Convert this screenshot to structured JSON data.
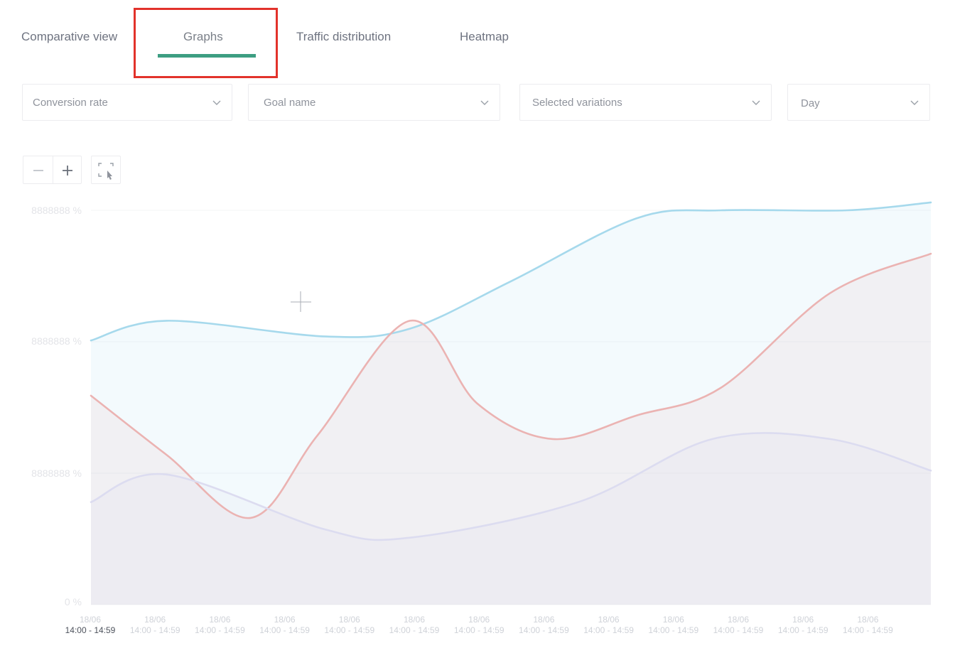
{
  "tabs": [
    {
      "label": "Comparative view"
    },
    {
      "label": "Graphs"
    },
    {
      "label": "Traffic distribution"
    },
    {
      "label": "Heatmap"
    }
  ],
  "active_tab": "Graphs",
  "filters": {
    "metric": "Conversion rate",
    "goal": "Goal name",
    "variations": "Selected variations",
    "granularity": "Day"
  },
  "icons": {
    "zoom_out": "minus-icon",
    "zoom_in": "plus-icon",
    "fit": "fit-selection-icon",
    "dropdown": "chevron-down-icon",
    "cursor": "crosshair-cursor-icon"
  },
  "colors": {
    "tab_underline": "#3d9e82",
    "highlight": "#e2322b",
    "series_blue": "#a6d9ec",
    "series_red": "#ebb3b2",
    "series_lavender": "#dcdcf0"
  },
  "chart_data": {
    "type": "area",
    "y_tick_labels": [
      "8888888 %",
      "8888888 %",
      "8888888 %",
      "0 %"
    ],
    "categories": [
      {
        "date": "18/06",
        "time": "14:00 - 14:59"
      },
      {
        "date": "18/06",
        "time": "14:00 - 14:59"
      },
      {
        "date": "18/06",
        "time": "14:00 - 14:59"
      },
      {
        "date": "18/06",
        "time": "14:00 - 14:59"
      },
      {
        "date": "18/06",
        "time": "14:00 - 14:59"
      },
      {
        "date": "18/06",
        "time": "14:00 - 14:59"
      },
      {
        "date": "18/06",
        "time": "14:00 - 14:59"
      },
      {
        "date": "18/06",
        "time": "14:00 - 14:59"
      },
      {
        "date": "18/06",
        "time": "14:00 - 14:59"
      },
      {
        "date": "18/06",
        "time": "14:00 - 14:59"
      },
      {
        "date": "18/06",
        "time": "14:00 - 14:59"
      },
      {
        "date": "18/06",
        "time": "14:00 - 14:59"
      },
      {
        "date": "18/06",
        "time": "14:00 - 14:59"
      }
    ],
    "series": [
      {
        "color": "#a6d9ec",
        "points": [
          [
            0,
            0.67
          ],
          [
            0.09,
            0.72
          ],
          [
            0.28,
            0.68
          ],
          [
            0.38,
            0.7
          ],
          [
            0.5,
            0.82
          ],
          [
            0.65,
            0.98
          ],
          [
            0.75,
            1.0
          ],
          [
            0.9,
            1.0
          ],
          [
            1.0,
            1.02
          ]
        ]
      },
      {
        "color": "#ebb3b2",
        "points": [
          [
            0,
            0.53
          ],
          [
            0.09,
            0.38
          ],
          [
            0.19,
            0.22
          ],
          [
            0.27,
            0.43
          ],
          [
            0.38,
            0.72
          ],
          [
            0.46,
            0.51
          ],
          [
            0.55,
            0.42
          ],
          [
            0.65,
            0.48
          ],
          [
            0.75,
            0.55
          ],
          [
            0.88,
            0.79
          ],
          [
            1.0,
            0.89
          ]
        ]
      },
      {
        "color": "#dcdcf0",
        "points": [
          [
            0,
            0.26
          ],
          [
            0.09,
            0.33
          ],
          [
            0.28,
            0.19
          ],
          [
            0.38,
            0.17
          ],
          [
            0.58,
            0.26
          ],
          [
            0.74,
            0.42
          ],
          [
            0.88,
            0.42
          ],
          [
            1.0,
            0.34
          ]
        ]
      }
    ],
    "grid": true,
    "legend": "none"
  }
}
